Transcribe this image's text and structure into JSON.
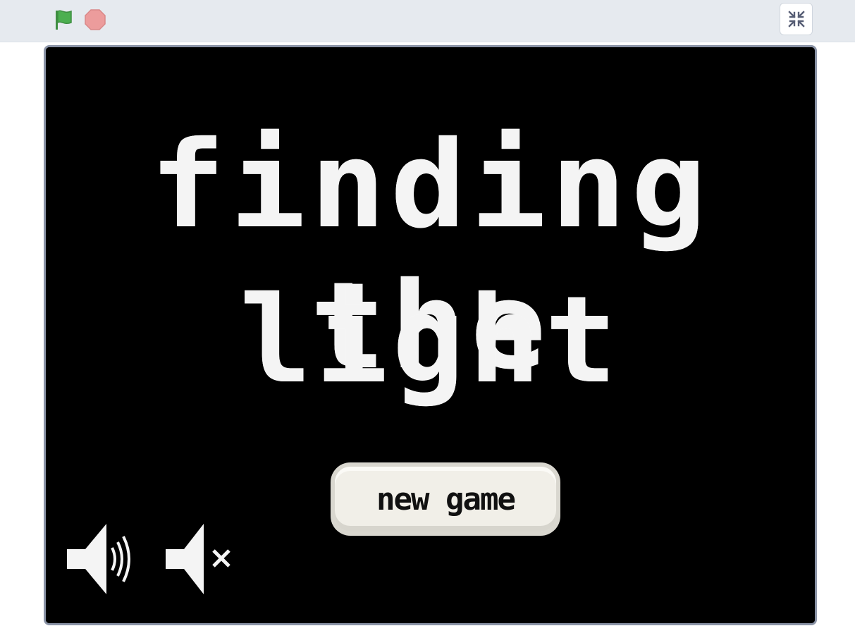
{
  "toolbar": {
    "green_flag_icon": "green-flag-icon",
    "stop_icon": "stop-icon",
    "fullscreen_exit_icon": "exit-fullscreen-icon",
    "flag_color": "#4caf50",
    "stop_color": "#ec9c9c"
  },
  "game": {
    "title_line_1": "finding the",
    "title_line_2": "light",
    "new_game_label": "new game",
    "sound_on_icon": "speaker-on-icon",
    "sound_off_icon": "speaker-mute-icon",
    "background_color": "#000000",
    "text_color": "#f4f4f4"
  }
}
